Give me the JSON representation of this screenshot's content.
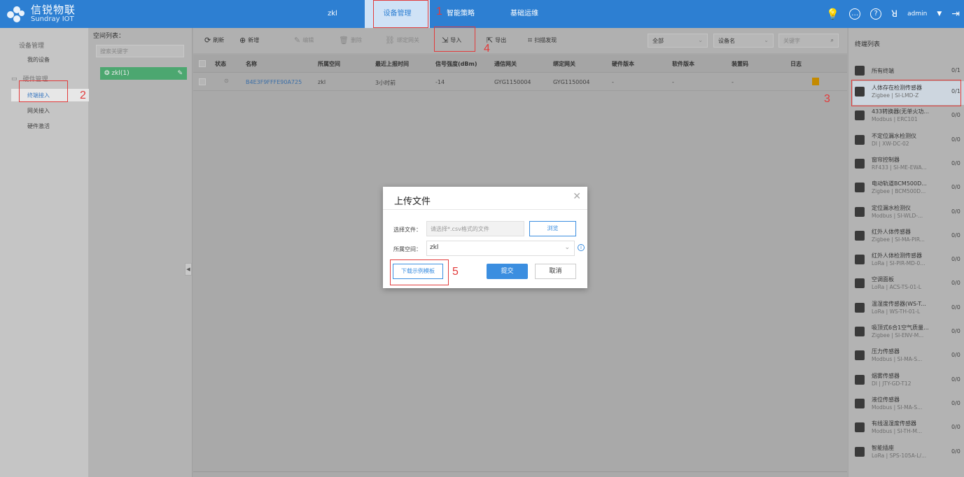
{
  "brand": {
    "name_cn": "信锐物联",
    "name_en": "Sundray IOT"
  },
  "topnav": {
    "space": "zkl",
    "device_mgmt": "设备管理",
    "smart_policy": "智能策略",
    "basic_ops": "基础运维",
    "user": "admin"
  },
  "sidebar": {
    "title": "设备管理",
    "my_devices": "我的设备",
    "hardware_mgmt": "硬件管理",
    "terminal_access": "终端接入",
    "gateway_access": "网关接入",
    "hardware_activate": "硬件激活"
  },
  "tree": {
    "title": "空间列表：",
    "search_placeholder": "搜索关键字",
    "node": "zkl(1)"
  },
  "toolbar": {
    "refresh": "刷新",
    "add": "新增",
    "edit": "编辑",
    "delete": "删除",
    "bind_gateway": "绑定网关",
    "import": "导入",
    "export": "导出",
    "scan": "扫描发现",
    "filter_all": "全部",
    "field": "设备名",
    "keyword_placeholder": "关键字"
  },
  "table": {
    "headers": [
      "状态",
      "名称",
      "所属空间",
      "最近上报时间",
      "信号强度(dBm)",
      "通信网关",
      "绑定网关",
      "硬件版本",
      "软件版本",
      "装置码",
      "日志"
    ],
    "row": {
      "name": "B4E3F9FFFE90A725",
      "space": "zkl",
      "last_report": "3小时前",
      "signal": "-14",
      "comm_gw": "GYG1150004",
      "bind_gw": "GYG1150004",
      "hw": "-",
      "sw": "-",
      "code": "-"
    }
  },
  "rightpanel": {
    "title": "终端列表",
    "items": [
      {
        "name": "所有终端",
        "sub": "",
        "count": "0/1"
      },
      {
        "name": "人体存在检测传感器",
        "sub": "Zigbee | SI-LMD-Z",
        "count": "0/1"
      },
      {
        "name": "433转换器(无单火功...",
        "sub": "Modbus | ERC101",
        "count": "0/0"
      },
      {
        "name": "不定位漏水检测仪",
        "sub": "DI | XW-DC-02",
        "count": "0/0"
      },
      {
        "name": "窗帘控制器",
        "sub": "RF433 | SI-ME-EWA...",
        "count": "0/0"
      },
      {
        "name": "电动轨道BCM500D...",
        "sub": "Zigbee | BCM500D...",
        "count": "0/0"
      },
      {
        "name": "定位漏水检测仪",
        "sub": "Modbus | SI-WLD-...",
        "count": "0/0"
      },
      {
        "name": "红外人体传感器",
        "sub": "Zigbee | SI-MA-PIR...",
        "count": "0/0"
      },
      {
        "name": "红外人体检测传感器",
        "sub": "LoRa | SI-PIR-MD-0...",
        "count": "0/0"
      },
      {
        "name": "空调面板",
        "sub": "LoRa | ACS-TS-01-L",
        "count": "0/0"
      },
      {
        "name": "温湿度传感器(WS-T...",
        "sub": "LoRa | WS-TH-01-L",
        "count": "0/0"
      },
      {
        "name": "吸顶式6合1空气质量...",
        "sub": "Zigbee | SI-ENV-M...",
        "count": "0/0"
      },
      {
        "name": "压力传感器",
        "sub": "Modbus | SI-MA-S...",
        "count": "0/0"
      },
      {
        "name": "烟雾传感器",
        "sub": "DI | JTY-GD-T12",
        "count": "0/0"
      },
      {
        "name": "液位传感器",
        "sub": "Modbus | SI-MA-S...",
        "count": "0/0"
      },
      {
        "name": "有线温湿度传感器",
        "sub": "Modbus | SI-TH-M...",
        "count": "0/0"
      },
      {
        "name": "智能插座",
        "sub": "LoRa | SPS-105A-L/...",
        "count": "0/0"
      }
    ]
  },
  "modal": {
    "title": "上传文件",
    "file_label": "选择文件：",
    "file_placeholder": "请选择*.csv格式的文件",
    "browse": "浏览",
    "space_label": "所属空间：",
    "space_value": "zkl",
    "download_template": "下载示例模板",
    "submit": "提交",
    "cancel": "取消"
  },
  "annotations": [
    "1",
    "2",
    "3",
    "4",
    "5"
  ],
  "colors": {
    "primary": "#2d7fd2",
    "accent": "#3b8ee0",
    "annotation": "#e23b3b"
  }
}
